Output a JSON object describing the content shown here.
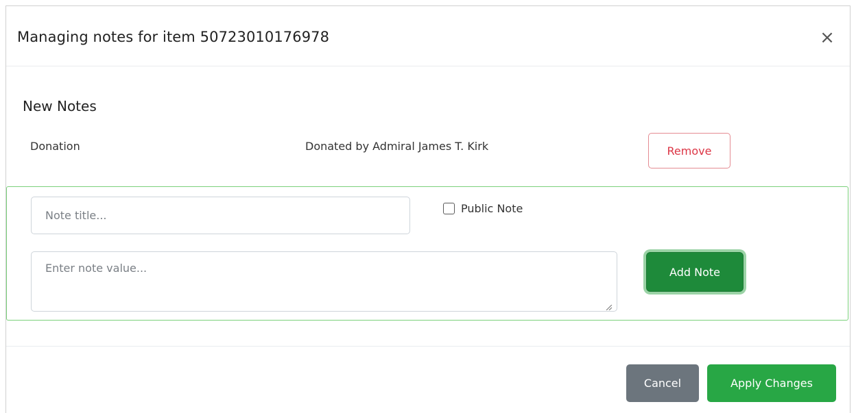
{
  "dialog": {
    "title": "Managing notes for item 50723010176978",
    "close_icon": "close-icon",
    "close_glyph": "×"
  },
  "new_notes": {
    "heading": "New Notes",
    "items": [
      {
        "title": "Donation",
        "value": "Donated by Admiral James T. Kirk",
        "remove_label": "Remove"
      }
    ]
  },
  "form": {
    "title_placeholder": "Note title...",
    "title_value": "",
    "public_label": "Public Note",
    "public_checked": false,
    "value_placeholder": "Enter note value...",
    "value_value": "",
    "add_label": "Add Note"
  },
  "footer": {
    "cancel_label": "Cancel",
    "apply_label": "Apply Changes"
  },
  "colors": {
    "accent_green": "#28a745",
    "add_note_green": "#1e8a3a",
    "danger_red": "#dc3545",
    "secondary_gray": "#6c757d"
  }
}
